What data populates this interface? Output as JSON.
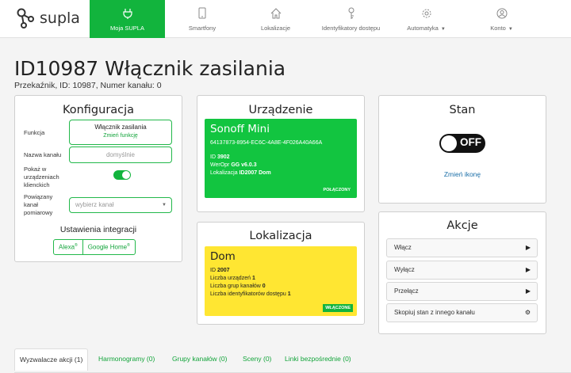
{
  "nav": {
    "brand": "supla",
    "items": [
      {
        "label": "Moja SUPLA",
        "icon": "power-plug-icon",
        "active": true
      },
      {
        "label": "Smartfony",
        "icon": "smartphone-icon"
      },
      {
        "label": "Lokalizacje",
        "icon": "home-icon"
      },
      {
        "label": "Identyfikatory dostępu",
        "icon": "key-icon"
      },
      {
        "label": "Automatyka",
        "icon": "gear-icon",
        "dropdown": true
      },
      {
        "label": "Konto",
        "icon": "user-icon",
        "dropdown": true
      }
    ]
  },
  "header": {
    "title": "ID10987 Włącznik zasilania",
    "subtitle": "Przekaźnik, ID: 10987, Numer kanału: 0"
  },
  "config": {
    "title": "Konfiguracja",
    "function_label": "Funkcja",
    "function_value": "Włącznik zasilania",
    "function_change": "Zmień funkcję",
    "name_label": "Nazwa kanału",
    "name_placeholder": "domyślnie",
    "show_label": "Pokaż w urządzeniach klienckich",
    "related_label": "Powiązany kanał pomiarowy",
    "related_placeholder": "wybierz kanał",
    "integrations_title": "Ustawienia integracji",
    "integrations": [
      "Alexa",
      "Google Home"
    ],
    "integration_mark": "®"
  },
  "device": {
    "title": "Urządzenie",
    "name": "Sonoff Mini",
    "guid": "64137873-8954-EC6C-4A8E-4F026A40A66A",
    "id_label": "ID",
    "id_value": "3902",
    "fw_label": "WerOpr",
    "fw_value": "GG v6.0.3",
    "loc_label": "Lokalizacja",
    "loc_value": "ID2007 Dom",
    "status": "POŁĄCZONY"
  },
  "location": {
    "title": "Lokalizacja",
    "name": "Dom",
    "id_label": "ID",
    "id_value": "2007",
    "devices_label": "Liczba urządzeń",
    "devices_value": "1",
    "groups_label": "Liczba grup kanałów",
    "groups_value": "0",
    "ids_label": "Liczba identyfikatorów dostępu",
    "ids_value": "1",
    "status": "WŁĄCZONE"
  },
  "state": {
    "title": "Stan",
    "switch_text": "OFF",
    "change_icon": "Zmień ikonę"
  },
  "actions": {
    "title": "Akcje",
    "buttons": [
      {
        "label": "Włącz",
        "icon": "play-icon"
      },
      {
        "label": "Wyłącz",
        "icon": "play-icon"
      },
      {
        "label": "Przełącz",
        "icon": "play-icon"
      },
      {
        "label": "Skopiuj stan z innego kanału",
        "icon": "gear-icon"
      }
    ]
  },
  "tabs": [
    {
      "label": "Wyzwalacze akcji (1)",
      "active": true
    },
    {
      "label": "Harmonogramy (0)"
    },
    {
      "label": "Grupy kanałów (0)"
    },
    {
      "label": "Sceny (0)"
    },
    {
      "label": "Linki bezpośrednie (0)"
    }
  ]
}
